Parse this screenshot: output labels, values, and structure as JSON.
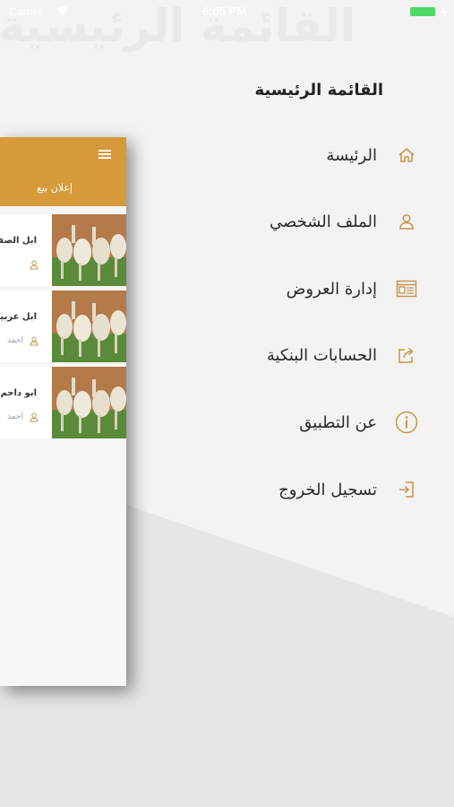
{
  "status_bar": {
    "carrier": "Carrier",
    "time": "6:05 PM"
  },
  "watermark": "القائمة الرئيسية",
  "menu": {
    "title": "القائمة الرئيسية",
    "items": [
      {
        "label": "الرئيسة",
        "icon": "home-icon"
      },
      {
        "label": "الملف الشخصي",
        "icon": "user-icon"
      },
      {
        "label": "إدارة العروض",
        "icon": "offers-icon"
      },
      {
        "label": "الحسابات البنكية",
        "icon": "share-icon"
      },
      {
        "label": "عن التطبيق",
        "icon": "info-icon"
      },
      {
        "label": "تسجيل الخروج",
        "icon": "logout-icon"
      }
    ]
  },
  "preview": {
    "subtitle": "إعلان بيع",
    "listings": [
      {
        "title": "ابل الصفر",
        "seller": ""
      },
      {
        "title": "ابل عربية",
        "seller": "احمد"
      },
      {
        "title": "ابو داحم",
        "seller": "احمد"
      }
    ]
  },
  "colors": {
    "accent": "#d69a3a",
    "icon": "#c8954a",
    "background": "#f3f3f3"
  }
}
